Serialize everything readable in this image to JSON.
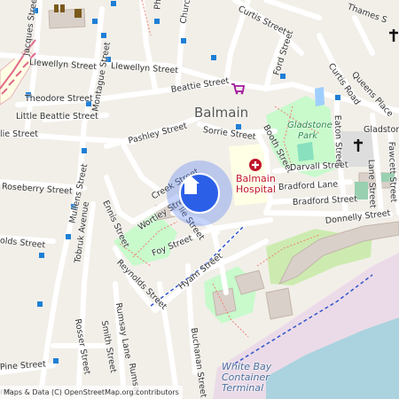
{
  "place": "Balmain",
  "park": "Gladstone Park",
  "hospital": "Balmain Hospital",
  "water": "White Bay Container Terminal",
  "attribution": "Maps & Data (C) OpenStreetMap.org contributors",
  "marker_icon": "home-icon",
  "streets": {
    "jacques": "Jacques Street",
    "phillip": "Phi",
    "church": "Church",
    "curtis_top": "Curtis Street",
    "thames": "Thames S",
    "llewellyn_left": "Llewellyn Street",
    "llewellyn_right": "Llewellyn Street",
    "montague": "Montague Street",
    "ford": "Ford Street",
    "curtis_road": "Curtis Road",
    "queens": "Queens Place",
    "theodore": "Theodore Street",
    "beattie": "Beattie Street",
    "little_beattie": "Little Beattie Street",
    "sorrie": "Sorrie Street",
    "booth": "Booth Street",
    "eaton": "Eaton Street",
    "gladstone": "Gladstone",
    "fawcett": "Fawcett Street",
    "pashley": "Pashley Street",
    "darvall": "Darvall Street",
    "lane": "Lane Street",
    "rosebery": "Roseberry Street",
    "mullens": "Mullens Street",
    "creek": "Creek Street",
    "bradford_lane": "Bradford Lane",
    "ennis": "Ennis Street",
    "wortley": "Wortley Street",
    "bradford_street": "Bradford Street",
    "tobruk": "Tobruk Avenue",
    "foy": "Foy Street",
    "donnelly": "Donnelly Street",
    "reynolds": "Reynolds Street",
    "hyam": "Hyam Street",
    "rumsay_lane": "Rumsay Lane",
    "smith": "Smith Street",
    "rosser": "Rosser Street",
    "rumsay": "Rumsay",
    "buchanan": "Buchanan Street",
    "pine": "Pine Street",
    "lie": "lie Street",
    "olds": "olds Street",
    "ret": "ret"
  }
}
